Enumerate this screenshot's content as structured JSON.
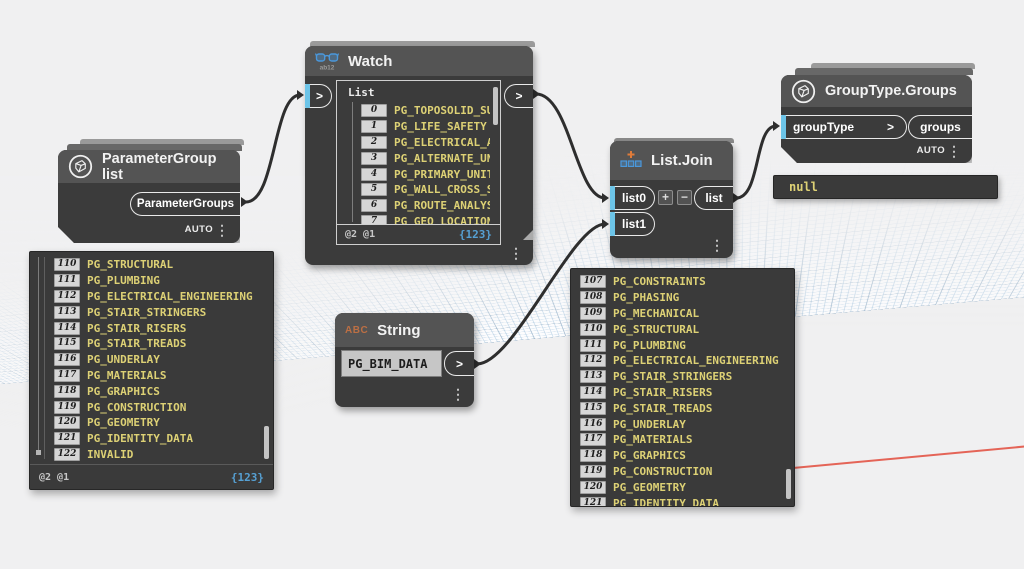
{
  "icons": {
    "context_menu": "⋮"
  },
  "colors": {
    "port_accent": "#6cc4e8",
    "item_text": "#ddd175",
    "count_text": "#56a0d3",
    "axis_x": "#e24b3c",
    "wire": "#2e2e2e"
  },
  "nodes": {
    "parameter_group_list": {
      "title": "ParameterGroup list",
      "output_port": "ParameterGroups",
      "lacing": "AUTO"
    },
    "watch": {
      "title": "Watch",
      "icon_caption": "ab12",
      "input_port": ">",
      "output_port": ">",
      "list_label": "List",
      "items": [
        {
          "index": "0",
          "value": "PG_TOPOSOLID_SUBD"
        },
        {
          "index": "1",
          "value": "PG_LIFE_SAFETY"
        },
        {
          "index": "2",
          "value": "PG_ELECTRICAL_ANA"
        },
        {
          "index": "3",
          "value": "PG_ALTERNATE_UNIT"
        },
        {
          "index": "4",
          "value": "PG_PRIMARY_UNITS"
        },
        {
          "index": "5",
          "value": "PG_WALL_CROSS_SEC"
        },
        {
          "index": "6",
          "value": "PG_ROUTE_ANALYSIS"
        },
        {
          "index": "7",
          "value": "PG_GEO_LOCATION"
        }
      ],
      "footer_left": "@2 @1",
      "footer_right": "{123}"
    },
    "string": {
      "title": "String",
      "icon_label": "ABC",
      "value": "PG_BIM_DATA",
      "output_port": ">"
    },
    "list_join": {
      "title": "List.Join",
      "input_ports": [
        "list0",
        "list1"
      ],
      "output_port": "list",
      "add_label": "+",
      "remove_label": "−"
    },
    "group_type_groups": {
      "title": "GroupType.Groups",
      "input_port": "groupType",
      "input_chevron": ">",
      "output_port": "groups",
      "lacing": "AUTO",
      "preview_value": "null"
    }
  },
  "previews": {
    "parameter_group_list": {
      "items": [
        {
          "index": "110",
          "value": "PG_STRUCTURAL"
        },
        {
          "index": "111",
          "value": "PG_PLUMBING"
        },
        {
          "index": "112",
          "value": "PG_ELECTRICAL_ENGINEERING"
        },
        {
          "index": "113",
          "value": "PG_STAIR_STRINGERS"
        },
        {
          "index": "114",
          "value": "PG_STAIR_RISERS"
        },
        {
          "index": "115",
          "value": "PG_STAIR_TREADS"
        },
        {
          "index": "116",
          "value": "PG_UNDERLAY"
        },
        {
          "index": "117",
          "value": "PG_MATERIALS"
        },
        {
          "index": "118",
          "value": "PG_GRAPHICS"
        },
        {
          "index": "119",
          "value": "PG_CONSTRUCTION"
        },
        {
          "index": "120",
          "value": "PG_GEOMETRY"
        },
        {
          "index": "121",
          "value": "PG_IDENTITY_DATA"
        },
        {
          "index": "122",
          "value": "INVALID"
        }
      ],
      "footer_left": "@2 @1",
      "footer_right": "{123}"
    },
    "list_join": {
      "items": [
        {
          "index": "107",
          "value": "PG_CONSTRAINTS"
        },
        {
          "index": "108",
          "value": "PG_PHASING"
        },
        {
          "index": "109",
          "value": "PG_MECHANICAL"
        },
        {
          "index": "110",
          "value": "PG_STRUCTURAL"
        },
        {
          "index": "111",
          "value": "PG_PLUMBING"
        },
        {
          "index": "112",
          "value": "PG_ELECTRICAL_ENGINEERING"
        },
        {
          "index": "113",
          "value": "PG_STAIR_STRINGERS"
        },
        {
          "index": "114",
          "value": "PG_STAIR_RISERS"
        },
        {
          "index": "115",
          "value": "PG_STAIR_TREADS"
        },
        {
          "index": "116",
          "value": "PG_UNDERLAY"
        },
        {
          "index": "117",
          "value": "PG_MATERIALS"
        },
        {
          "index": "118",
          "value": "PG_GRAPHICS"
        },
        {
          "index": "119",
          "value": "PG_CONSTRUCTION"
        },
        {
          "index": "120",
          "value": "PG_GEOMETRY"
        },
        {
          "index": "121",
          "value": "PG_IDENTITY_DATA"
        }
      ]
    }
  }
}
